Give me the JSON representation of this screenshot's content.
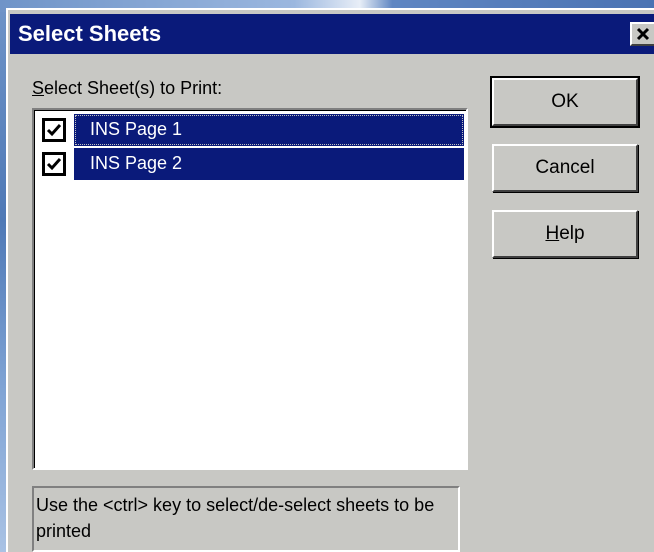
{
  "dialog": {
    "title": "Select Sheets",
    "close_glyph": "✕"
  },
  "list": {
    "label_first_letter": "S",
    "label_rest": "elect Sheet(s) to Print:",
    "items": [
      {
        "label": "INS Page 1",
        "checked": true,
        "selected": true
      },
      {
        "label": "INS Page 2",
        "checked": true,
        "selected": true
      }
    ]
  },
  "buttons": {
    "ok": "OK",
    "cancel": "Cancel",
    "help_first_letter": "H",
    "help_rest": "elp"
  },
  "hint": {
    "text": "Use the <ctrl> key to select/de-select sheets to be printed"
  },
  "colors": {
    "titlebar": "#0a1a7a",
    "selection": "#0a1a7a",
    "dialog_bg": "#c8c8c4"
  },
  "icons": {
    "checkbox": "checkmark-icon",
    "close": "close-icon"
  }
}
